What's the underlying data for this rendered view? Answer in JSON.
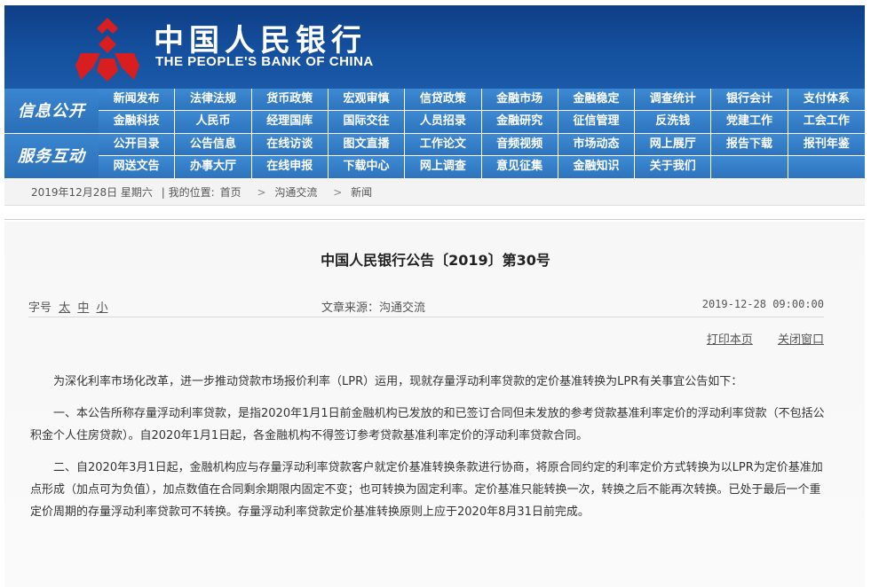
{
  "header": {
    "bank_name_cn": "中国人民银行",
    "bank_name_en": "THE PEOPLE'S BANK OF CHINA",
    "colors": {
      "banner": "#14509e",
      "logo": "#d81e1e",
      "nav": "#3a86cf"
    }
  },
  "nav": {
    "group1": {
      "label": "信息公开",
      "row1": [
        "新闻发布",
        "法律法规",
        "货币政策",
        "宏观审慎",
        "信贷政策",
        "金融市场",
        "金融稳定",
        "调查统计",
        "银行会计",
        "支付体系"
      ],
      "row2": [
        "金融科技",
        "人民币",
        "经理国库",
        "国际交往",
        "人员招录",
        "金融研究",
        "征信管理",
        "反洗钱",
        "党建工作",
        "工会工作"
      ]
    },
    "group2": {
      "label": "服务互动",
      "row1": [
        "公开目录",
        "公告信息",
        "在线访谈",
        "图文直播",
        "工作论文",
        "音频视频",
        "市场动态",
        "网上展厅",
        "报告下载",
        "报刊年鉴"
      ],
      "row2": [
        "网送文告",
        "办事大厅",
        "在线申报",
        "下载中心",
        "网上调查",
        "意见征集",
        "金融知识",
        "关于我们",
        "",
        ""
      ]
    }
  },
  "breadcrumb": {
    "date": "2019年12月28日 星期六",
    "location_label": "| 我的位置:",
    "items": [
      "首页",
      "沟通交流",
      "新闻"
    ],
    "separator": ">"
  },
  "article": {
    "title": "中国人民银行公告〔2019〕第30号",
    "font_size_label": "字号",
    "font_sizes": [
      "太",
      "中",
      "小"
    ],
    "source": "文章来源：沟通交流",
    "published": "2019-12-28 09:00:00",
    "print_label": "打印本页",
    "close_label": "关闭窗口",
    "paragraphs": [
      "为深化利率市场化改革，进一步推动贷款市场报价利率（LPR）运用，现就存量浮动利率贷款的定价基准转换为LPR有关事宜公告如下：",
      "一、本公告所称存量浮动利率贷款，是指2020年1月1日前金融机构已发放的和已签订合同但未发放的参考贷款基准利率定价的浮动利率贷款（不包括公积金个人住房贷款）。自2020年1月1日起，各金融机构不得签订参考贷款基准利率定价的浮动利率贷款合同。",
      "二、自2020年3月1日起，金融机构应与存量浮动利率贷款客户就定价基准转换条款进行协商，将原合同约定的利率定价方式转换为以LPR为定价基准加点形成（加点可为负值），加点数值在合同剩余期限内固定不变；也可转换为固定利率。定价基准只能转换一次，转换之后不能再次转换。已处于最后一个重定价周期的存量浮动利率贷款可不转换。存量浮动利率贷款定价基准转换原则上应于2020年8月31日前完成。"
    ]
  }
}
